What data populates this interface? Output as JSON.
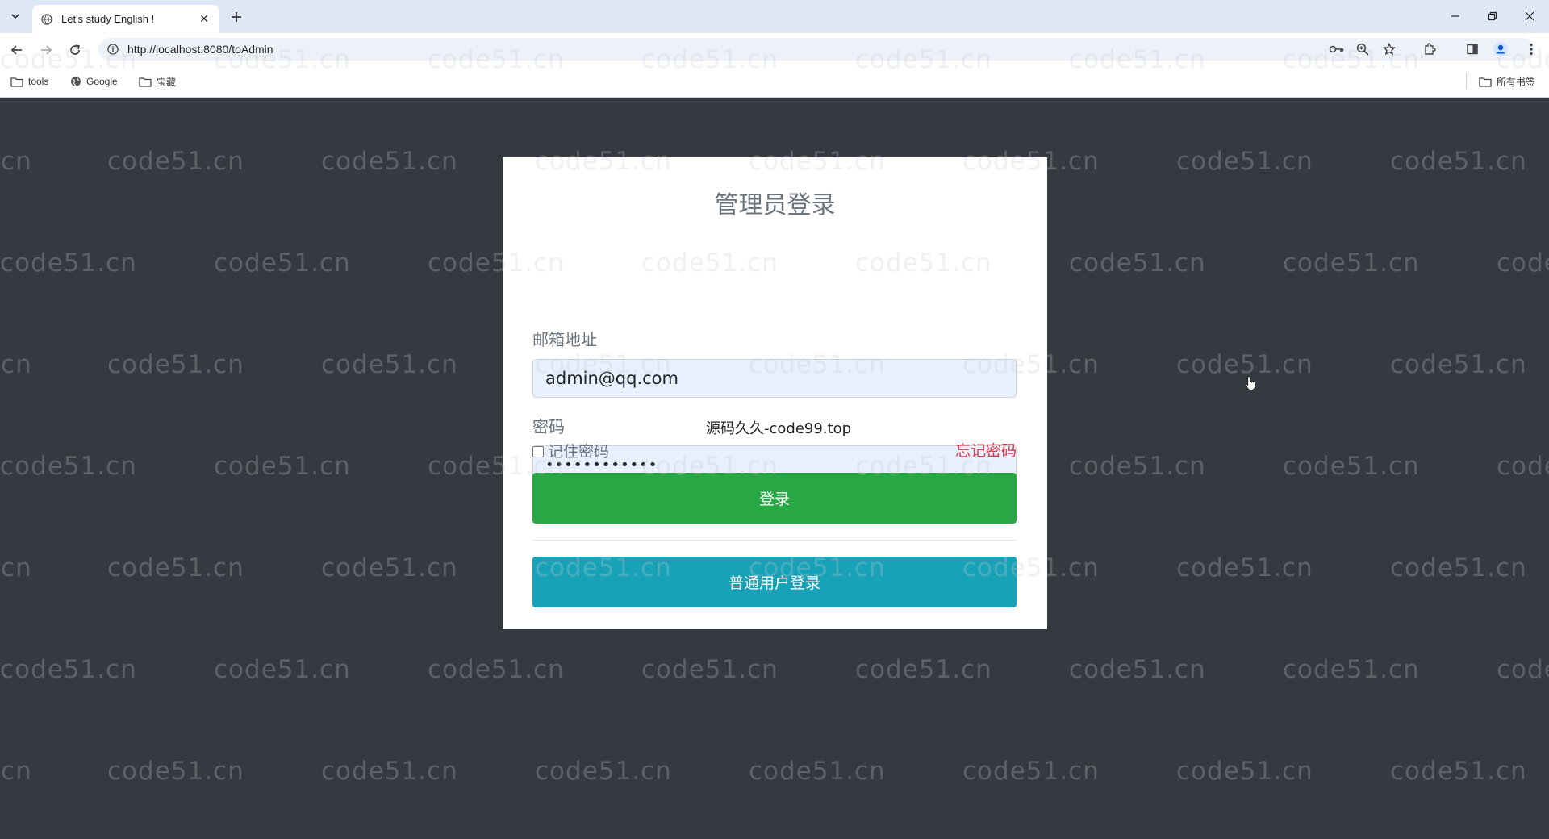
{
  "browser": {
    "tab_title": "Let's study English !",
    "url": "http://localhost:8080/toAdmin",
    "bookmarks": [
      "tools",
      "Google",
      "宝藏"
    ],
    "all_bookmarks": "所有书签"
  },
  "watermark": {
    "text": "code51.cn",
    "overlay": "源码久久-code99.top"
  },
  "login": {
    "title": "管理员登录",
    "email_label": "邮箱地址",
    "email_value": "admin@qq.com",
    "password_label": "密码",
    "password_value": "••••••••••••",
    "remember_label": "记住密码",
    "forgot_label": "忘记密码",
    "login_button": "登录",
    "user_login_button": "普通用户登录"
  },
  "colors": {
    "page_bg": "#343a40",
    "login_button": "#28a745",
    "user_button": "#17a2b8",
    "forgot_link": "#dc3545"
  }
}
